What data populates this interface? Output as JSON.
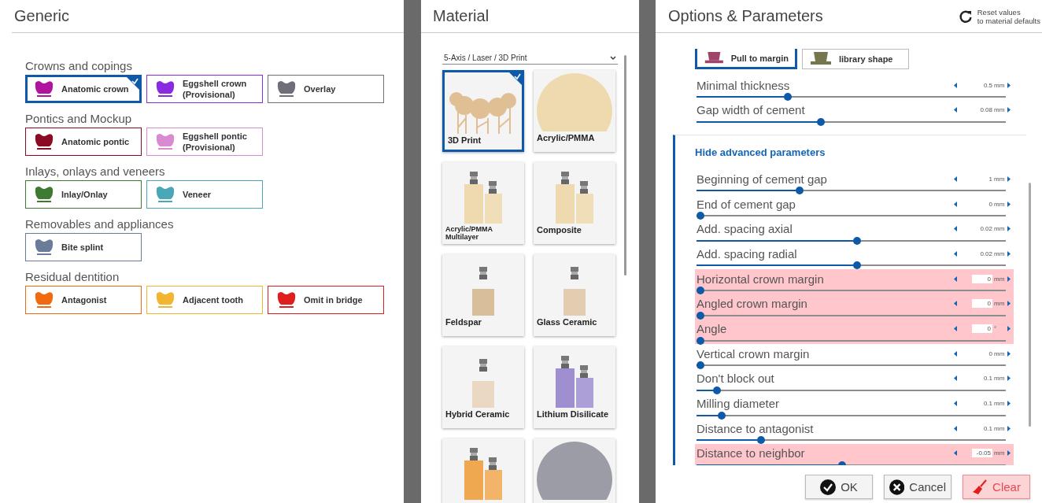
{
  "generic": {
    "title": "Generic",
    "groups": [
      {
        "heading": "Crowns and copings",
        "items": [
          {
            "label": "Anatomic crown",
            "color": "#b0149e",
            "selected": true
          },
          {
            "label": "Eggshell crown (Provisional)",
            "color": "#8a2be2",
            "selected": false
          },
          {
            "label": "Overlay",
            "color": "#6f6f7a",
            "selected": false
          }
        ]
      },
      {
        "heading": "Pontics and Mockup",
        "items": [
          {
            "label": "Anatomic pontic",
            "color": "#8b0a24",
            "selected": false
          },
          {
            "label": "Eggshell pontic (Provisional)",
            "color": "#d98ad0",
            "selected": false
          }
        ]
      },
      {
        "heading": "Inlays, onlays and veneers",
        "items": [
          {
            "label": "Inlay/Onlay",
            "color": "#3f7a32",
            "selected": false
          },
          {
            "label": "Veneer",
            "color": "#4aa7b5",
            "selected": false
          }
        ]
      },
      {
        "heading": "Removables and appliances",
        "items": [
          {
            "label": "Bite splint",
            "color": "#6a7c9a",
            "selected": false
          }
        ]
      },
      {
        "heading": "Residual dentition",
        "items": [
          {
            "label": "Antagonist",
            "color": "#f26a10",
            "selected": false
          },
          {
            "label": "Adjacent tooth",
            "color": "#f2b530",
            "selected": false
          },
          {
            "label": "Omit in bridge",
            "color": "#e01e1e",
            "selected": false
          }
        ]
      }
    ]
  },
  "material": {
    "title": "Material",
    "dropdown": {
      "value": "5-Axis / Laser / 3D Print"
    },
    "tiles": [
      {
        "label": "3D Print",
        "kind": "print",
        "color": "#e0bf94",
        "selected": true
      },
      {
        "label": "Acrylic/PMMA",
        "kind": "disc",
        "color": "#efd9ae",
        "selected": false
      },
      {
        "label": "Acrylic/PMMA Multilayer",
        "kind": "blocks",
        "color": "#efd9ae",
        "selected": false
      },
      {
        "label": "Composite",
        "kind": "blocks",
        "color": "#efd9ae",
        "selected": false
      },
      {
        "label": "Feldspar",
        "kind": "block",
        "color": "#d8bf9a",
        "selected": false
      },
      {
        "label": "Glass Ceramic",
        "kind": "block",
        "color": "#e2cdb0",
        "selected": false
      },
      {
        "label": "Hybrid Ceramic",
        "kind": "block",
        "color": "#ead8c2",
        "selected": false
      },
      {
        "label": "Lithium Disilicate",
        "kind": "blocks",
        "color": "#9f8ed0",
        "selected": false
      },
      {
        "kind": "blocks",
        "color": "#f0a850",
        "selected": false
      },
      {
        "kind": "disc",
        "color": "#9c9ca6",
        "selected": false
      }
    ]
  },
  "options": {
    "title": "Options & Parameters",
    "reset": {
      "lines": [
        "Reset values",
        "to material defaults"
      ]
    },
    "shape_buttons": [
      {
        "label": "Pull to margin",
        "color": "#a0446c",
        "selected": true
      },
      {
        "label": "library shape",
        "color": "#77774f",
        "selected": false
      }
    ],
    "sliders": [
      {
        "label": "Minimal thickness",
        "value": "0.5",
        "unit": "mm",
        "level": 0.29,
        "highlighted": false
      },
      {
        "label": "Gap width of cement",
        "value": "0.08",
        "unit": "mm",
        "level": 0.4,
        "highlighted": false
      }
    ],
    "advanced": {
      "toggle": "Hide advanced parameters",
      "expanded": true,
      "sliders": [
        {
          "label": "Beginning of cement gap",
          "value": "1",
          "unit": "mm",
          "level": 0.33,
          "highlighted": false
        },
        {
          "label": "End of cement gap",
          "value": "0",
          "unit": "mm",
          "level": 0,
          "highlighted": false
        },
        {
          "label": "Add. spacing axial",
          "value": "0.02",
          "unit": "mm",
          "level": 0.52,
          "highlighted": false
        },
        {
          "label": "Add. spacing radial",
          "value": "0.02",
          "unit": "mm",
          "level": 0.52,
          "highlighted": false
        },
        {
          "label": "Horizontal crown margin",
          "value": "0",
          "unit": "mm",
          "level": 0,
          "highlighted": true
        },
        {
          "label": "Angled crown margin",
          "value": "0",
          "unit": "mm",
          "level": 0,
          "highlighted": true
        },
        {
          "label": "Angle",
          "value": "0",
          "unit": "°",
          "level": 0,
          "highlighted": true
        },
        {
          "label": "Vertical crown margin",
          "value": "0",
          "unit": "mm",
          "level": 0,
          "highlighted": false
        },
        {
          "label": "Don't block out",
          "value": "0.1",
          "unit": "mm",
          "level": 0.055,
          "highlighted": false
        },
        {
          "label": "Milling diameter",
          "value": "0.1",
          "unit": "mm",
          "level": 0.07,
          "highlighted": false
        },
        {
          "label": "Distance to antagonist",
          "value": "0.1",
          "unit": "mm",
          "level": 0.2,
          "highlighted": false
        },
        {
          "label": "Distance to neighbor",
          "value": "-0.05",
          "unit": "mm",
          "level": 0.47,
          "highlighted": true
        }
      ]
    },
    "buttons": [
      {
        "label": "OK",
        "kind": "ok"
      },
      {
        "label": "Cancel",
        "kind": "cancel"
      },
      {
        "label": "Clear",
        "kind": "clear"
      }
    ]
  }
}
